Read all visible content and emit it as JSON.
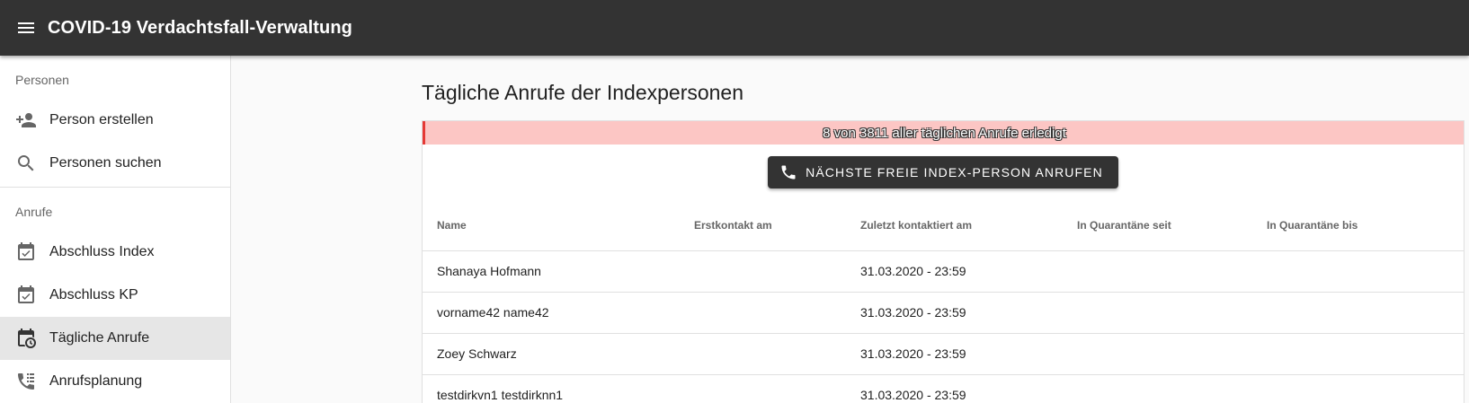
{
  "app": {
    "title": "COVID-19 Verdachtsfall-Verwaltung"
  },
  "sidebar": {
    "sections": [
      {
        "label": "Personen",
        "items": [
          {
            "label": "Person erstellen",
            "icon": "person-add-icon",
            "active": false
          },
          {
            "label": "Personen suchen",
            "icon": "search-icon",
            "active": false
          }
        ]
      },
      {
        "label": "Anrufe",
        "items": [
          {
            "label": "Abschluss Index",
            "icon": "event-available-icon",
            "active": false
          },
          {
            "label": "Abschluss KP",
            "icon": "event-available-icon",
            "active": false
          },
          {
            "label": "Tägliche Anrufe",
            "icon": "calendar-clock-icon",
            "active": true
          },
          {
            "label": "Anrufsplanung",
            "icon": "phone-list-icon",
            "active": false
          }
        ]
      }
    ]
  },
  "main": {
    "title": "Tägliche Anrufe der Indexpersonen",
    "progress": {
      "text": "8 von 3811 aller täglichen Anrufe erledigt",
      "done": 8,
      "total": 3811
    },
    "call_button": {
      "label": "NÄCHSTE FREIE INDEX-PERSON ANRUFEN"
    },
    "table": {
      "headers": [
        "Name",
        "Erstkontakt am",
        "Zuletzt kontaktiert am",
        "In Quarantäne seit",
        "In Quarantäne bis"
      ],
      "rows": [
        [
          "Shanaya Hofmann",
          "",
          "31.03.2020 - 23:59",
          "",
          ""
        ],
        [
          "vorname42 name42",
          "",
          "31.03.2020 - 23:59",
          "",
          ""
        ],
        [
          "Zoey Schwarz",
          "",
          "31.03.2020 - 23:59",
          "",
          ""
        ],
        [
          "testdirkvn1 testdirknn1",
          "",
          "31.03.2020 - 23:59",
          "",
          ""
        ]
      ]
    }
  },
  "colors": {
    "toolbar": "#333333",
    "banner_bg": "#fcc6c4",
    "banner_border": "#e53935",
    "active_nav": "#e6e6e6"
  }
}
